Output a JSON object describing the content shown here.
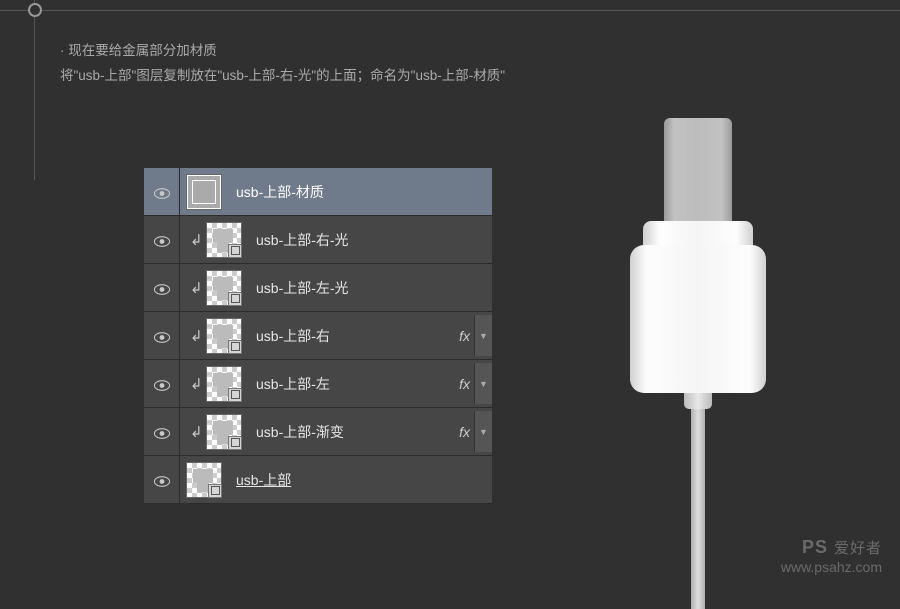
{
  "instructions": {
    "line1": "· 现在要给金属部分加材质",
    "line2": "将\"usb-上部\"图层复制放在\"usb-上部-右-光\"的上面；命名为\"usb-上部-材质\""
  },
  "layers": [
    {
      "name": "usb-上部-材质",
      "selected": true,
      "clipped": false,
      "fx": false,
      "visible": true,
      "thumb": "solid",
      "underline": false
    },
    {
      "name": "usb-上部-右-光",
      "selected": false,
      "clipped": true,
      "fx": false,
      "visible": true,
      "thumb": "shape",
      "underline": false
    },
    {
      "name": "usb-上部-左-光",
      "selected": false,
      "clipped": true,
      "fx": false,
      "visible": true,
      "thumb": "shape",
      "underline": false
    },
    {
      "name": "usb-上部-右",
      "selected": false,
      "clipped": true,
      "fx": true,
      "visible": true,
      "thumb": "shape",
      "underline": false
    },
    {
      "name": "usb-上部-左",
      "selected": false,
      "clipped": true,
      "fx": true,
      "visible": true,
      "thumb": "shape",
      "underline": false
    },
    {
      "name": "usb-上部-渐变",
      "selected": false,
      "clipped": true,
      "fx": true,
      "visible": true,
      "thumb": "shape",
      "underline": false
    },
    {
      "name": "usb-上部",
      "selected": false,
      "clipped": false,
      "fx": false,
      "visible": true,
      "thumb": "shape",
      "underline": true
    }
  ],
  "fxLabel": "fx",
  "watermark": {
    "brand": "PS 爱好者",
    "url": "www.psahz.com"
  }
}
